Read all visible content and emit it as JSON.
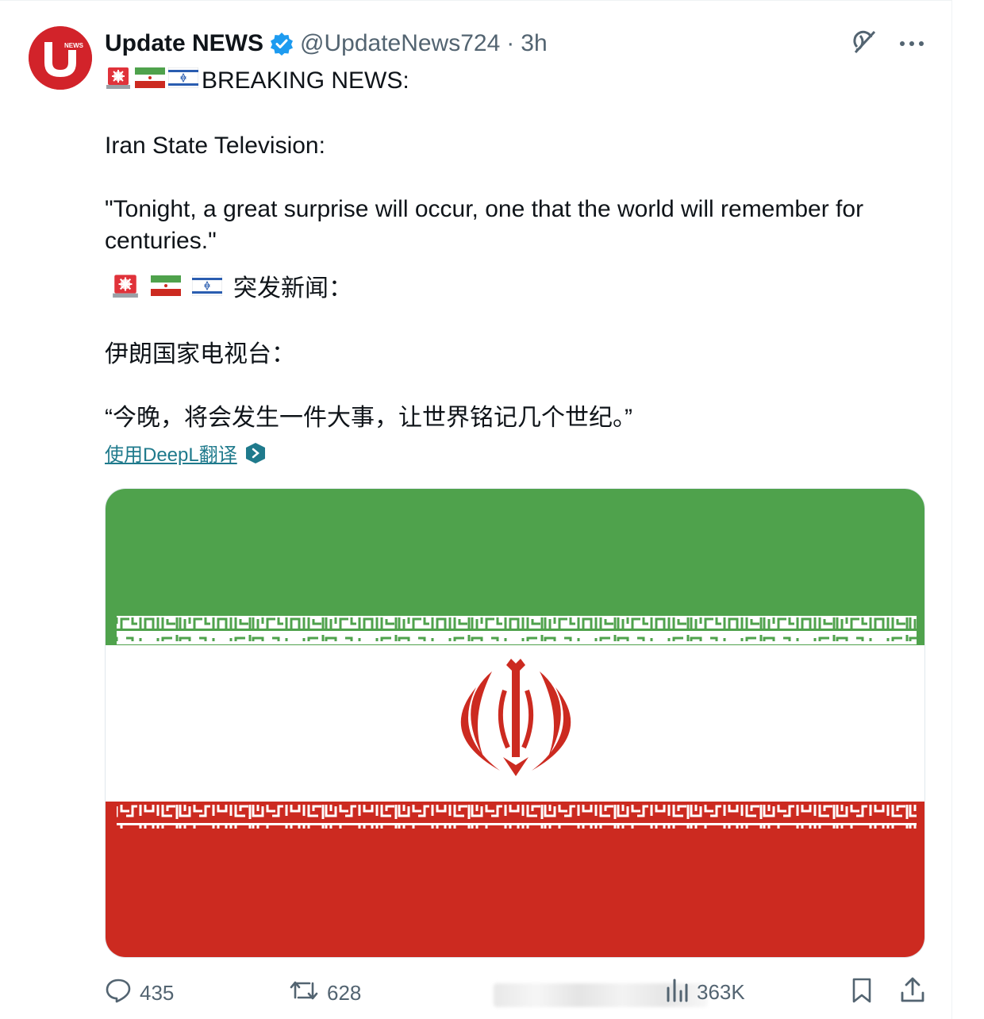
{
  "post": {
    "author": {
      "display_name": "Update NEWS",
      "handle": "@UpdateNews724",
      "separator": "·",
      "time": "3h",
      "verified": true,
      "avatar_logo_text": "NEWS"
    },
    "text": {
      "line1": "BREAKING NEWS:",
      "line2": "Iran State Television:",
      "line3": "\"Tonight, a great surprise will occur, one that the world will remember for centuries.\"",
      "zh_line1": "突发新闻：",
      "zh_line2": "伊朗国家电视台：",
      "zh_line3": "“今晚，将会发生一件大事，让世界铭记几个世纪。”"
    },
    "emojis": [
      "rotating-light",
      "iran-flag",
      "israel-flag"
    ],
    "translate_link": "使用DeepL翻译",
    "media": {
      "description_icon": "iran-flag-image",
      "colors": {
        "green": "#4fa24c",
        "white": "#ffffff",
        "red": "#cc2a20"
      }
    },
    "actions": {
      "replies": "435",
      "reposts": "628",
      "views": "363K"
    }
  },
  "colors": {
    "accent": "#1d9bf0",
    "muted": "#536471",
    "text": "#0f1419"
  }
}
